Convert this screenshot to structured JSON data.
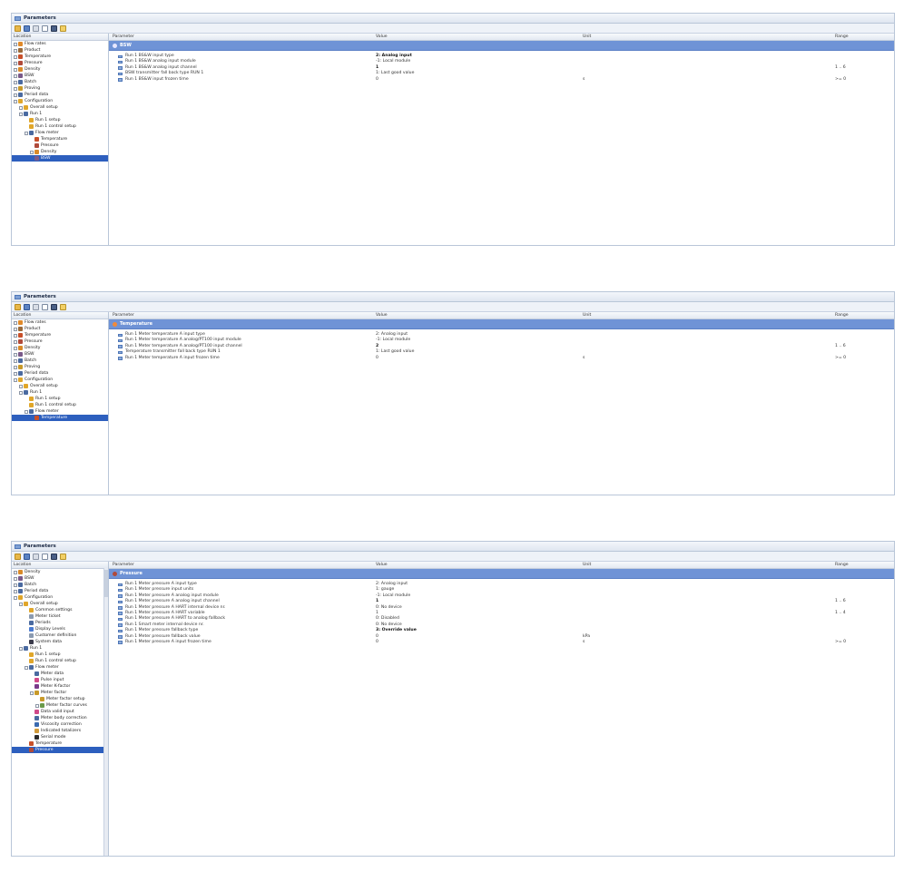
{
  "panels": [
    {
      "title": "Parameters",
      "columns": {
        "location": "Location",
        "parameter": "Parameter",
        "value": "Value",
        "unit": "Unit",
        "range": "Range"
      },
      "tree": [
        {
          "label": "Flow rates",
          "indent": 0,
          "exp": true,
          "color": "#e08a2a"
        },
        {
          "label": "Product",
          "indent": 0,
          "exp": true,
          "color": "#9a6a3a"
        },
        {
          "label": "Temperature",
          "indent": 0,
          "exp": true,
          "color": "#c8502a"
        },
        {
          "label": "Pressure",
          "indent": 0,
          "exp": true,
          "color": "#b04a3a"
        },
        {
          "label": "Density",
          "indent": 0,
          "exp": true,
          "color": "#d98a2a"
        },
        {
          "label": "BSW",
          "indent": 0,
          "exp": true,
          "color": "#7a5a8a"
        },
        {
          "label": "Batch",
          "indent": 0,
          "exp": true,
          "color": "#4a6aa0"
        },
        {
          "label": "Proving",
          "indent": 0,
          "exp": true,
          "color": "#c89a2a"
        },
        {
          "label": "Period data",
          "indent": 0,
          "exp": true,
          "color": "#4a6aa0"
        },
        {
          "label": "Configuration",
          "indent": 0,
          "exp": true,
          "color": "#e0a62a"
        },
        {
          "label": "Overall setup",
          "indent": 1,
          "exp": true,
          "color": "#e0a62a"
        },
        {
          "label": "Run 1",
          "indent": 1,
          "exp": true,
          "color": "#4a6aa0"
        },
        {
          "label": "Run 1 setup",
          "indent": 2,
          "exp": false,
          "color": "#e0a62a"
        },
        {
          "label": "Run 1 control setup",
          "indent": 2,
          "exp": false,
          "color": "#e0a62a"
        },
        {
          "label": "Flow meter",
          "indent": 2,
          "exp": true,
          "color": "#4a6aa0"
        },
        {
          "label": "Temperature",
          "indent": 3,
          "exp": false,
          "color": "#c8502a"
        },
        {
          "label": "Pressure",
          "indent": 3,
          "exp": false,
          "color": "#b04a3a"
        },
        {
          "label": "Density",
          "indent": 3,
          "exp": true,
          "color": "#d98a2a"
        },
        {
          "label": "BSW",
          "indent": 3,
          "exp": false,
          "color": "#7a5a8a",
          "selected": true
        }
      ],
      "group": "BSW",
      "group_color": "#e7e7ff",
      "rows": [
        {
          "param": "Run 1 BS&W input type",
          "value": "2: Analog input",
          "unit": "",
          "range": "",
          "bold": true
        },
        {
          "param": "Run 1 BS&W analog input module",
          "value": "-1: Local module",
          "unit": "",
          "range": ""
        },
        {
          "param": "Run 1 BS&W analog input channel",
          "value": "1",
          "unit": "",
          "range": "1 .. 6",
          "bold": true
        },
        {
          "param": "BSW transmitter fall back type RUN 1",
          "value": "1: Last good value",
          "unit": "",
          "range": ""
        },
        {
          "param": "Run 1 BS&W input frozen time",
          "value": "0",
          "unit": "s",
          "range": ">= 0"
        }
      ]
    },
    {
      "title": "Parameters",
      "columns": {
        "location": "Location",
        "parameter": "Parameter",
        "value": "Value",
        "unit": "Unit",
        "range": "Range"
      },
      "tree": [
        {
          "label": "Flow rates",
          "indent": 0,
          "exp": true,
          "color": "#e08a2a"
        },
        {
          "label": "Product",
          "indent": 0,
          "exp": true,
          "color": "#9a6a3a"
        },
        {
          "label": "Temperature",
          "indent": 0,
          "exp": true,
          "color": "#c8502a"
        },
        {
          "label": "Pressure",
          "indent": 0,
          "exp": true,
          "color": "#b04a3a"
        },
        {
          "label": "Density",
          "indent": 0,
          "exp": true,
          "color": "#d98a2a"
        },
        {
          "label": "BSW",
          "indent": 0,
          "exp": true,
          "color": "#7a5a8a"
        },
        {
          "label": "Batch",
          "indent": 0,
          "exp": true,
          "color": "#4a6aa0"
        },
        {
          "label": "Proving",
          "indent": 0,
          "exp": true,
          "color": "#c89a2a"
        },
        {
          "label": "Period data",
          "indent": 0,
          "exp": true,
          "color": "#4a6aa0"
        },
        {
          "label": "Configuration",
          "indent": 0,
          "exp": true,
          "color": "#e0a62a"
        },
        {
          "label": "Overall setup",
          "indent": 1,
          "exp": true,
          "color": "#e0a62a"
        },
        {
          "label": "Run 1",
          "indent": 1,
          "exp": true,
          "color": "#4a6aa0"
        },
        {
          "label": "Run 1 setup",
          "indent": 2,
          "exp": false,
          "color": "#e0a62a"
        },
        {
          "label": "Run 1 control setup",
          "indent": 2,
          "exp": false,
          "color": "#e0a62a"
        },
        {
          "label": "Flow meter",
          "indent": 2,
          "exp": true,
          "color": "#4a6aa0"
        },
        {
          "label": "Temperature",
          "indent": 3,
          "exp": false,
          "color": "#c8502a",
          "selected": true
        }
      ],
      "group": "Temperature",
      "group_color": "#f08a3a",
      "rows": [
        {
          "param": "Run 1 Meter temperature A input type",
          "value": "2: Analog input",
          "unit": "",
          "range": ""
        },
        {
          "param": "Run 1 Meter temperature A analog/PT100 input module",
          "value": "-1: Local module",
          "unit": "",
          "range": ""
        },
        {
          "param": "Run 1 Meter temperature A analog/PT100 input channel",
          "value": "2",
          "unit": "",
          "range": "1 .. 6",
          "bold": true
        },
        {
          "param": "Temperature transmitter fall back type RUN 1",
          "value": "1: Last good value",
          "unit": "",
          "range": ""
        },
        {
          "param": "Run 1 Meter temperature A input frozen time",
          "value": "0",
          "unit": "s",
          "range": ">= 0"
        }
      ]
    },
    {
      "title": "Parameters",
      "columns": {
        "location": "Location",
        "parameter": "Parameter",
        "value": "Value",
        "unit": "Unit",
        "range": "Range"
      },
      "tree": [
        {
          "label": "Density",
          "indent": 0,
          "exp": true,
          "color": "#d98a2a"
        },
        {
          "label": "BSW",
          "indent": 0,
          "exp": true,
          "color": "#7a5a8a"
        },
        {
          "label": "Batch",
          "indent": 0,
          "exp": true,
          "color": "#4a6aa0"
        },
        {
          "label": "Period data",
          "indent": 0,
          "exp": true,
          "color": "#4a6aa0"
        },
        {
          "label": "Configuration",
          "indent": 0,
          "exp": true,
          "color": "#e0a62a"
        },
        {
          "label": "Overall setup",
          "indent": 1,
          "exp": true,
          "color": "#e0a62a"
        },
        {
          "label": "Common settings",
          "indent": 2,
          "exp": false,
          "color": "#e0a62a"
        },
        {
          "label": "Meter ticket",
          "indent": 2,
          "exp": false,
          "color": "#8a9ab0"
        },
        {
          "label": "Periods",
          "indent": 2,
          "exp": false,
          "color": "#4a6aa0"
        },
        {
          "label": "Display Levels",
          "indent": 2,
          "exp": false,
          "color": "#4a7ad0"
        },
        {
          "label": "Customer definition",
          "indent": 2,
          "exp": false,
          "color": "#8a9ab0"
        },
        {
          "label": "System data",
          "indent": 2,
          "exp": false,
          "color": "#3a3a4a"
        },
        {
          "label": "Run 1",
          "indent": 1,
          "exp": true,
          "color": "#4a6aa0"
        },
        {
          "label": "Run 1 setup",
          "indent": 2,
          "exp": false,
          "color": "#e0a62a"
        },
        {
          "label": "Run 1 control setup",
          "indent": 2,
          "exp": false,
          "color": "#e0a62a"
        },
        {
          "label": "Flow meter",
          "indent": 2,
          "exp": true,
          "color": "#4a6aa0"
        },
        {
          "label": "Meter data",
          "indent": 3,
          "exp": false,
          "color": "#4a6aa0"
        },
        {
          "label": "Pulse input",
          "indent": 3,
          "exp": false,
          "color": "#d04a8a"
        },
        {
          "label": "Meter K-factor",
          "indent": 3,
          "exp": false,
          "color": "#7a3a8a"
        },
        {
          "label": "Meter factor",
          "indent": 3,
          "exp": true,
          "color": "#c89a2a"
        },
        {
          "label": "Meter factor setup",
          "indent": 4,
          "exp": false,
          "color": "#c89a2a"
        },
        {
          "label": "Meter factor curves",
          "indent": 4,
          "exp": true,
          "color": "#6a9a4a"
        },
        {
          "label": "Data valid input",
          "indent": 3,
          "exp": false,
          "color": "#d04a8a"
        },
        {
          "label": "Meter body correction",
          "indent": 3,
          "exp": false,
          "color": "#4a6aa0"
        },
        {
          "label": "Viscosity correction",
          "indent": 3,
          "exp": false,
          "color": "#3a6ab0"
        },
        {
          "label": "Indicated totalizers",
          "indent": 3,
          "exp": false,
          "color": "#d09a3a"
        },
        {
          "label": "Serial mode",
          "indent": 3,
          "exp": false,
          "color": "#2a2a2a"
        },
        {
          "label": "Temperature",
          "indent": 2,
          "exp": false,
          "color": "#c8502a"
        },
        {
          "label": "Pressure",
          "indent": 2,
          "exp": false,
          "color": "#b04a3a",
          "selected": true
        }
      ],
      "group": "Pressure",
      "group_color": "#b04a3a",
      "rows": [
        {
          "param": "Run 1 Meter pressure A input type",
          "value": "2: Analog input",
          "unit": "",
          "range": ""
        },
        {
          "param": "Run 1 Meter pressure input units",
          "value": "1: gauge",
          "unit": "",
          "range": ""
        },
        {
          "param": "Run 1 Meter pressure A analog input module",
          "value": "-1: Local module",
          "unit": "",
          "range": ""
        },
        {
          "param": "Run 1 Meter pressure A analog input channel",
          "value": "1",
          "unit": "",
          "range": "1 .. 6",
          "bold": true
        },
        {
          "param": "Run 1 Meter pressure A HART internal device nr.",
          "value": "0: No device",
          "unit": "",
          "range": ""
        },
        {
          "param": "Run 1 Meter pressure A HART variable",
          "value": "1",
          "unit": "",
          "range": "1 .. 4"
        },
        {
          "param": "Run 1 Meter pressure A HART to analog fallback",
          "value": "0: Disabled",
          "unit": "",
          "range": ""
        },
        {
          "param": "Run 1 Smart meter internal device nr.",
          "value": "0: No device",
          "unit": "",
          "range": ""
        },
        {
          "param": "Run 1 Meter pressure fallback type",
          "value": "3: Override value",
          "unit": "",
          "range": "",
          "bold": true
        },
        {
          "param": "Run 1 Meter pressure fallback value",
          "value": "0",
          "unit": "kPa",
          "range": ""
        },
        {
          "param": "Run 1 Meter pressure A input frozen time",
          "value": "0",
          "unit": "s",
          "range": ">= 0"
        }
      ]
    }
  ]
}
